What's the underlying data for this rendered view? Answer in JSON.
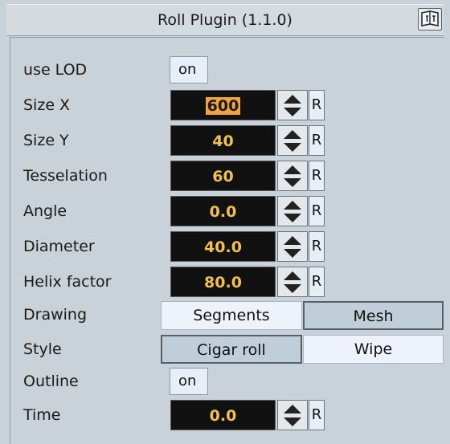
{
  "title": "Roll Plugin (1.1.0)",
  "icons": {
    "help": "help-book-icon",
    "spin_up": "arrow-up-icon",
    "spin_down": "arrow-down-icon"
  },
  "colors": {
    "field_bg": "#111111",
    "field_text": "#f1c24b",
    "selection": "#f0a43a",
    "panel_bg": "#c9d2d8"
  },
  "fields": {
    "use_lod": {
      "label": "use LOD",
      "value": "on"
    },
    "size_x": {
      "label": "Size X",
      "value": "600",
      "reset": "R"
    },
    "size_y": {
      "label": "Size Y",
      "value": "40",
      "reset": "R"
    },
    "tesselation": {
      "label": "Tesselation",
      "value": "60",
      "reset": "R"
    },
    "angle": {
      "label": "Angle",
      "value": "0.0",
      "reset": "R"
    },
    "diameter": {
      "label": "Diameter",
      "value": "40.0",
      "reset": "R"
    },
    "helix_factor": {
      "label": "Helix factor",
      "value": "80.0",
      "reset": "R"
    },
    "drawing": {
      "label": "Drawing",
      "options": [
        "Segments",
        "Mesh"
      ],
      "selected": "Segments"
    },
    "style": {
      "label": "Style",
      "options": [
        "Cigar roll",
        "Wipe"
      ],
      "selected": "Cigar roll"
    },
    "outline": {
      "label": "Outline",
      "value": "on"
    },
    "time": {
      "label": "Time",
      "value": "0.0",
      "reset": "R"
    }
  }
}
